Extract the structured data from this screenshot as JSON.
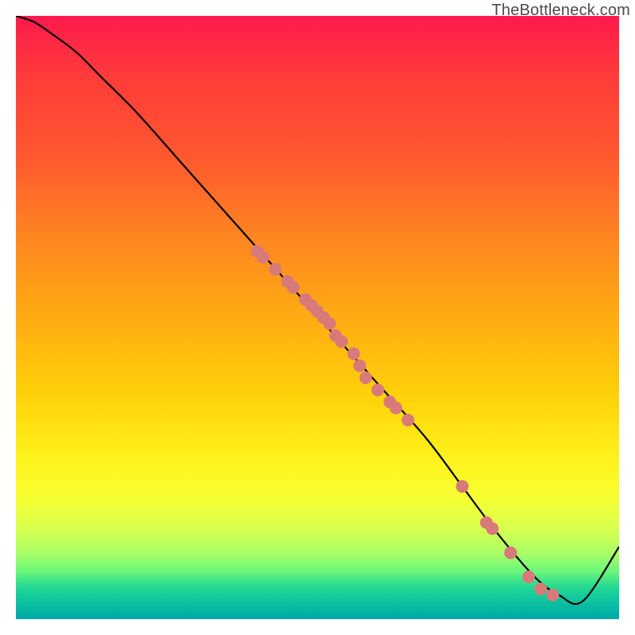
{
  "attribution": "TheBottleneck.com",
  "chart_data": {
    "type": "line",
    "title": "",
    "xlabel": "",
    "ylabel": "",
    "xlim": [
      0,
      100
    ],
    "ylim": [
      0,
      100
    ],
    "grid": false,
    "legend": false,
    "background_gradient": {
      "top": "#ff1a4d",
      "bottom": "#00a8a8",
      "via": [
        "#ff8a1f",
        "#ffd40a",
        "#d8ff4d"
      ]
    },
    "series": [
      {
        "name": "bottleneck-curve",
        "color": "#000000",
        "x": [
          0,
          3,
          6,
          10,
          14,
          20,
          28,
          36,
          44,
          52,
          60,
          68,
          74,
          80,
          86,
          90,
          94,
          100
        ],
        "y": [
          100,
          99,
          97,
          94,
          90,
          84,
          75,
          66,
          57,
          48,
          39,
          30,
          22,
          14,
          7,
          4,
          3,
          12
        ]
      }
    ],
    "markers": {
      "name": "highlighted-points",
      "color": "#d87a7a",
      "points": [
        {
          "x": 40,
          "y": 61
        },
        {
          "x": 41,
          "y": 60
        },
        {
          "x": 43,
          "y": 58
        },
        {
          "x": 45,
          "y": 56
        },
        {
          "x": 46,
          "y": 55
        },
        {
          "x": 48,
          "y": 53
        },
        {
          "x": 49,
          "y": 52
        },
        {
          "x": 50,
          "y": 51
        },
        {
          "x": 51,
          "y": 50
        },
        {
          "x": 52,
          "y": 49
        },
        {
          "x": 53,
          "y": 47
        },
        {
          "x": 54,
          "y": 46
        },
        {
          "x": 56,
          "y": 44
        },
        {
          "x": 57,
          "y": 42
        },
        {
          "x": 58,
          "y": 40
        },
        {
          "x": 60,
          "y": 38
        },
        {
          "x": 62,
          "y": 36
        },
        {
          "x": 63,
          "y": 35
        },
        {
          "x": 65,
          "y": 33
        },
        {
          "x": 74,
          "y": 22
        },
        {
          "x": 78,
          "y": 16
        },
        {
          "x": 79,
          "y": 15
        },
        {
          "x": 82,
          "y": 11
        },
        {
          "x": 85,
          "y": 7
        },
        {
          "x": 87,
          "y": 5
        },
        {
          "x": 89,
          "y": 4
        }
      ]
    }
  }
}
